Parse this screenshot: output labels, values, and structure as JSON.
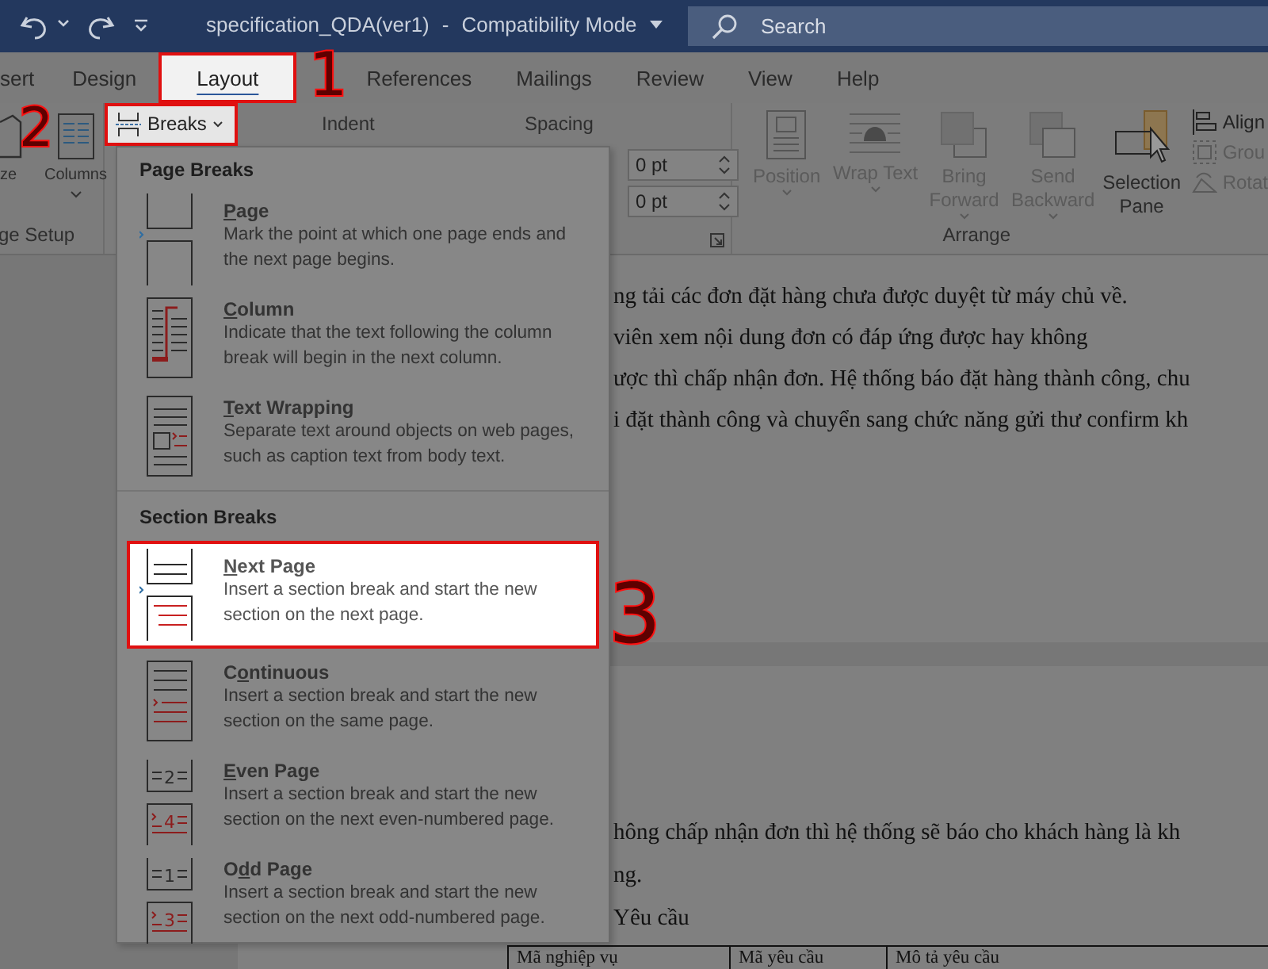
{
  "window": {
    "title": "specification_QDA(ver1)",
    "separator": "-",
    "mode": "Compatibility Mode",
    "search_placeholder": "Search"
  },
  "tabs": [
    {
      "label": "sert",
      "selected": false
    },
    {
      "label": "Design",
      "selected": false
    },
    {
      "label": "Layout",
      "selected": true
    },
    {
      "label": "References",
      "selected": false
    },
    {
      "label": "Mailings",
      "selected": false
    },
    {
      "label": "Review",
      "selected": false
    },
    {
      "label": "View",
      "selected": false
    },
    {
      "label": "Help",
      "selected": false
    }
  ],
  "ribbon": {
    "page_setup": {
      "buttons": [
        {
          "label": "ze",
          "kind": "size"
        },
        {
          "label": "Columns",
          "kind": "columns"
        }
      ],
      "group_label": "ge Setup"
    },
    "breaks_button": {
      "label": "Breaks",
      "highlighted": true
    },
    "paragraph": {
      "indent_label": "Indent",
      "spacing_label": "Spacing",
      "spacing_fields": [
        {
          "value": "0 pt"
        },
        {
          "value": "0 pt"
        }
      ]
    },
    "arrange": {
      "buttons": [
        {
          "label": "Position",
          "kind": "position",
          "disabled": true
        },
        {
          "label": "Wrap Text",
          "kind": "wrap",
          "disabled": true
        },
        {
          "label": "Bring Forward",
          "kind": "bring",
          "disabled": true
        },
        {
          "label": "Send Backward",
          "kind": "send",
          "disabled": true
        },
        {
          "label": "Selection Pane",
          "kind": "selection",
          "disabled": false
        }
      ],
      "small_buttons": [
        {
          "label": "Align",
          "kind": "align",
          "disabled": false
        },
        {
          "label": "Grou",
          "kind": "group",
          "disabled": true
        },
        {
          "label": "Rotat",
          "kind": "rotate",
          "disabled": true
        }
      ],
      "group_label": "Arrange"
    }
  },
  "breaks_menu": {
    "sections": [
      {
        "heading": "Page Breaks",
        "items": [
          {
            "kind": "page",
            "access_key": "P",
            "title_after": "age",
            "description": "Mark the point at which one page ends and the next page begins.",
            "selected": false
          },
          {
            "kind": "column",
            "access_key": "C",
            "title_after": "olumn",
            "description": "Indicate that the text following the column break will begin in the next column.",
            "selected": false
          },
          {
            "kind": "text_wrapping",
            "access_key": "T",
            "title_after": "ext Wrapping",
            "description": "Separate text around objects on web pages, such as caption text from body text.",
            "selected": false
          }
        ]
      },
      {
        "heading": "Section Breaks",
        "items": [
          {
            "kind": "next_page",
            "access_key": "N",
            "title_after": "ext Page",
            "description": "Insert a section break and start the new section on the next page.",
            "selected": true
          },
          {
            "kind": "continuous",
            "title_before": "C",
            "access_key": "o",
            "title_after": "ntinuous",
            "description": "Insert a section break and start the new section on the same page.",
            "selected": false
          },
          {
            "kind": "even_page",
            "access_key": "E",
            "title_after": "ven Page",
            "description": "Insert a section break and start the new section on the next even-numbered page.",
            "icon_numbers": [
              "2",
              "4"
            ],
            "selected": false
          },
          {
            "kind": "odd_page",
            "title_before": "O",
            "access_key": "d",
            "title_after": "d Page",
            "description": "Insert a section break and start the new section on the next odd-numbered page.",
            "icon_numbers": [
              "1",
              "3"
            ],
            "selected": false
          }
        ]
      }
    ]
  },
  "document": {
    "lines_top": [
      "ng tải các đơn đặt hàng chưa được duyệt từ máy chủ về.",
      "viên xem nội dung đơn có đáp ứng được hay không",
      "ược thì chấp nhận đơn. Hệ thống báo đặt hàng thành công, chu",
      "i đặt thành công và chuyển sang chức năng gửi thư confirm kh"
    ],
    "lines_bottom": [
      "hông chấp nhận đơn thì hệ thống sẽ báo cho khách hàng là kh",
      "ng.",
      "Yêu cầu"
    ],
    "table": {
      "columns": [
        "Mã nghiệp vụ",
        "Mã yêu cầu",
        "Mô tả yêu cầu"
      ]
    }
  },
  "annotations": [
    {
      "label": "1"
    },
    {
      "label": "2"
    },
    {
      "label": "3"
    }
  ]
}
